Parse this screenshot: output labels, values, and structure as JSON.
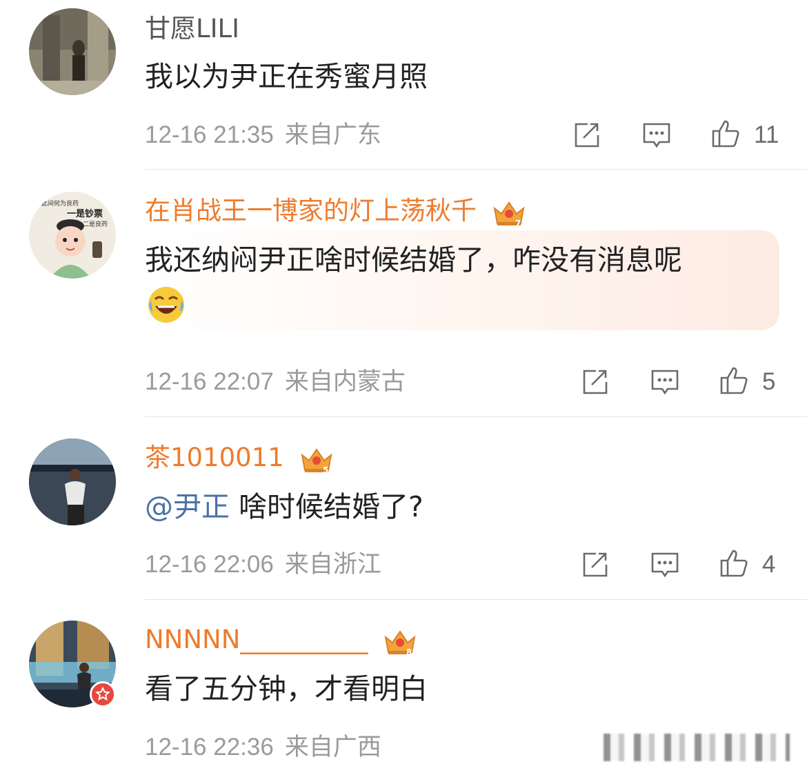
{
  "comments": [
    {
      "username": "甘愿LILI",
      "text": "我以为尹正在秀蜜月照",
      "time": "12-16 21:35",
      "location": "来自广东",
      "likes": "11"
    },
    {
      "username": "在肖战王一博家的灯上荡秋千",
      "vip_level": "7",
      "text": "我还纳闷尹正啥时候结婚了，咋没有消息呢",
      "emoji": "laughing-tears",
      "time": "12-16 22:07",
      "location": "来自内蒙古",
      "likes": "5",
      "avatar_text": {
        "line1": "此间何为良药",
        "line2": "一是钞票",
        "line3": "二是良药"
      }
    },
    {
      "username": "茶1010011",
      "vip_level": "5",
      "mention": "@尹正",
      "text": " 啥时候结婚了?",
      "time": "12-16 22:06",
      "location": "来自浙江",
      "likes": "4"
    },
    {
      "username": "NNNNN__________",
      "vip_level": "8",
      "text": "看了五分钟，才看明白",
      "time": "12-16 22:36",
      "location": "来自广西"
    }
  ],
  "colors": {
    "vip_name": "#ee7b2c",
    "plain_name": "#555555",
    "mention": "#4b72a6",
    "meta": "#9a9a9a",
    "divider": "#e4e4e4"
  },
  "icons": [
    "repost-icon",
    "comment-icon",
    "like-icon",
    "crown-icon",
    "verified-badge-icon"
  ]
}
